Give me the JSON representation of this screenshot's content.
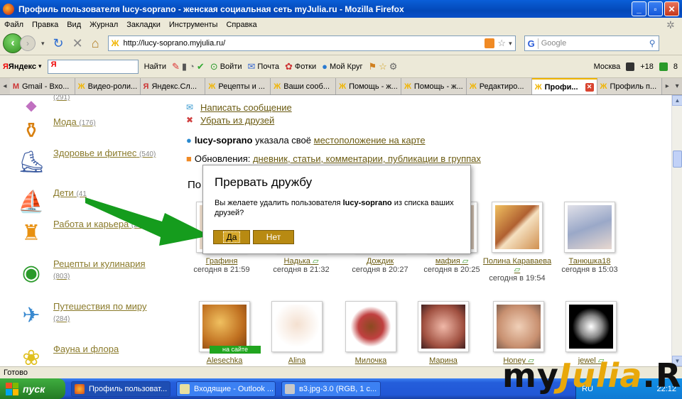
{
  "window": {
    "title": "Профиль пользователя lucy-soprano - женская социальная сеть myJulia.ru - Mozilla Firefox",
    "minimize": "_",
    "maximize": "▫",
    "close": "✕"
  },
  "menu": [
    "Файл",
    "Правка",
    "Вид",
    "Журнал",
    "Закладки",
    "Инструменты",
    "Справка"
  ],
  "nav": {
    "url": "http://lucy-soprano.myjulia.ru/",
    "search_placeholder": "Google"
  },
  "yandex_bar": {
    "logo_main": "Яндекс",
    "logo_input": "Я",
    "find": "Найти",
    "login": "Войти",
    "mail": "Почта",
    "photos": "Фотки",
    "mycircle": "Мой Круг",
    "city": "Москва",
    "temp": "+18",
    "count": "8"
  },
  "tabs": [
    {
      "label": "Gmail - Вхо...",
      "active": false
    },
    {
      "label": "Видео-роли...",
      "active": false
    },
    {
      "label": "Яндекс.Сл...",
      "active": false
    },
    {
      "label": "Рецепты и ...",
      "active": false
    },
    {
      "label": "Ваши сооб...",
      "active": false
    },
    {
      "label": "Помощь - ж...",
      "active": false
    },
    {
      "label": "Помощь - ж...",
      "active": false
    },
    {
      "label": "Редактиро...",
      "active": false
    },
    {
      "label": "Профи...",
      "active": true
    },
    {
      "label": "Профиль п...",
      "active": false
    }
  ],
  "sidebar": {
    "top_count": "(291)",
    "categories": [
      {
        "label": "Мода",
        "count": "(176)",
        "icon": "perfume-icon"
      },
      {
        "label": "Здоровье и фитнес",
        "count": "(540)",
        "icon": "treadmill-icon"
      },
      {
        "label": "Дети",
        "count": "(41",
        "icon": "kids-icon"
      },
      {
        "label": "Работа и карьера",
        "count": "(215)",
        "icon": "office-chair-icon"
      },
      {
        "label": "Рецепты и кулинария",
        "count": "(803)",
        "icon": "cooking-pot-icon"
      },
      {
        "label": "Путешествия по миру",
        "count": "(284)",
        "icon": "globe-plane-icon"
      },
      {
        "label": "Фауна и флора",
        "count": "",
        "icon": "flower-icon"
      }
    ]
  },
  "profile": {
    "write_message": "Написать сообщение",
    "remove_friend": "Убрать из друзей",
    "username": "lucy-soprano",
    "location_text": "указала своё",
    "location_link": "местоположение на карте",
    "updates_label": "Обновления:",
    "updates_links": "дневник, статьи, комментарии, публикации в группах",
    "friends_heading_visible": "По"
  },
  "dialog": {
    "title": "Прервать дружбу",
    "text_before": "Вы желаете удалить пользователя",
    "username": "lucy-soprano",
    "text_after": "из списка ваших друзей?",
    "yes": "Да",
    "no": "Нет"
  },
  "friends_row1": [
    {
      "name": "Графиня",
      "date": "сегодня в 21:59",
      "online": true
    },
    {
      "name": "Надька",
      "date": "сегодня в 21:32",
      "online": false
    },
    {
      "name": "Дождик",
      "date": "сегодня в 20:27",
      "online": false
    },
    {
      "name": "мафия",
      "date": "сегодня в 20:25",
      "online": false
    },
    {
      "name": "Полина Караваева",
      "date": "сегодня в 19:54",
      "online": false
    },
    {
      "name": "Танюшка18",
      "date": "сегодня в 15:03",
      "online": false
    }
  ],
  "friends_row2": [
    {
      "name": "Alesechka",
      "online": true,
      "badge": "на сайте"
    },
    {
      "name": "Alina",
      "online": false
    },
    {
      "name": "Милочка",
      "online": false
    },
    {
      "name": "Марина",
      "online": false
    },
    {
      "name": "Honey",
      "online": false
    },
    {
      "name": "jewel",
      "online": false
    }
  ],
  "status": "Готово",
  "taskbar": {
    "start": "пуск",
    "tasks": [
      "Профиль пользоват...",
      "Входящие - Outlook ...",
      "в3.jpg-3.0 (RGB, 1 с..."
    ],
    "lang": "RU",
    "clock": "22:12"
  },
  "watermark": {
    "part1": "my",
    "part2": "Julia",
    "part3": ".Ru"
  }
}
